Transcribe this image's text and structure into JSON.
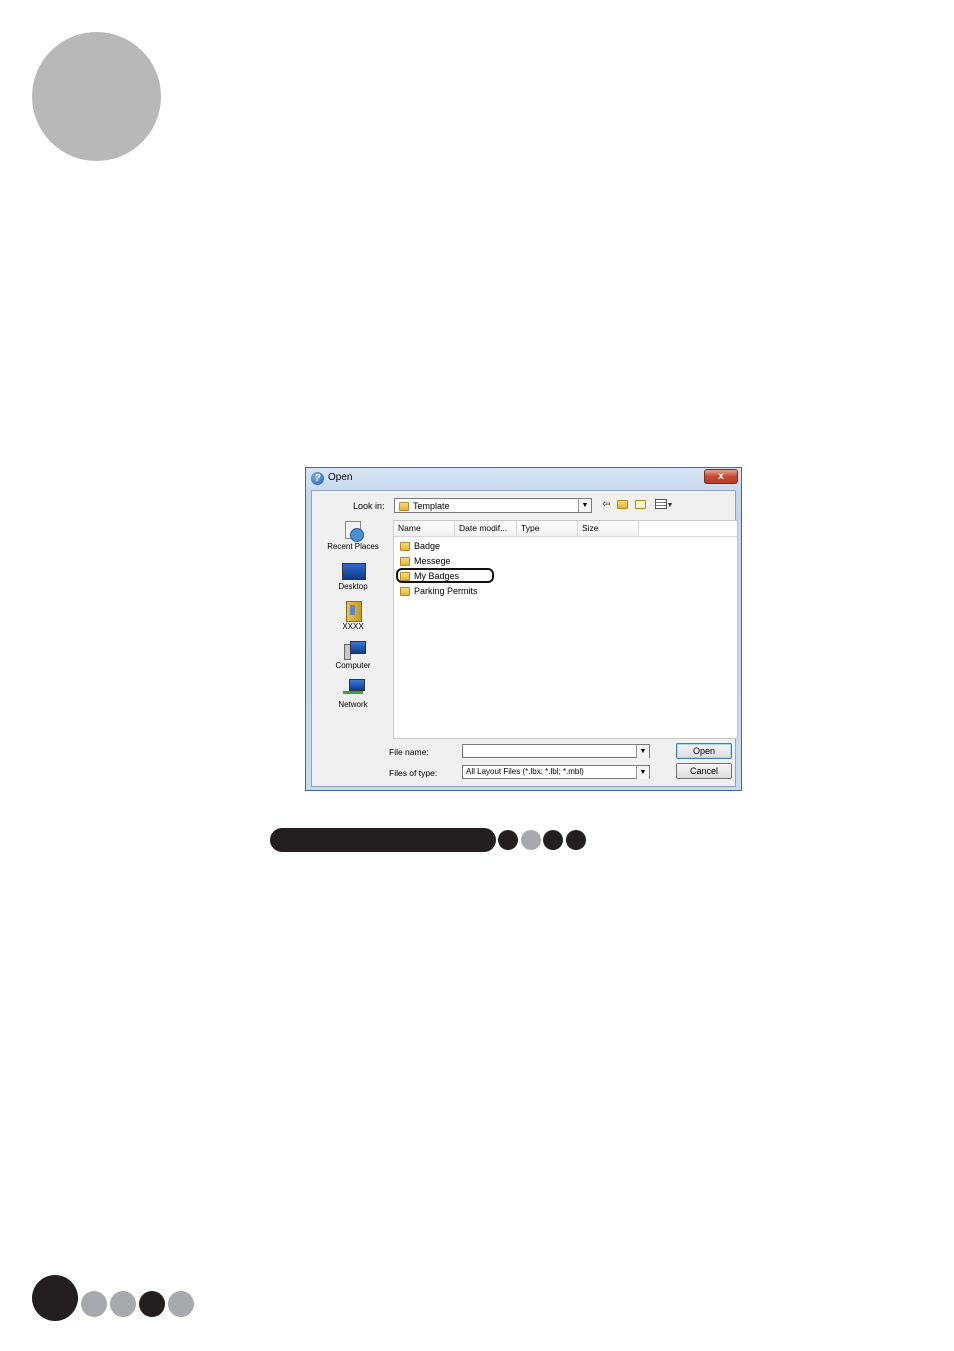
{
  "dialog": {
    "title": "Open",
    "close_glyph": "x",
    "look_in_label": "Look in:",
    "look_in_value": "Template",
    "toolbar_icons": [
      "back-icon",
      "up-folder-icon",
      "new-folder-icon",
      "views-menu-icon"
    ],
    "places": [
      {
        "label": "Recent Places",
        "icon": "recent-places-icon"
      },
      {
        "label": "Desktop",
        "icon": "desktop-icon"
      },
      {
        "label": "XXXX",
        "icon": "user-folder-icon"
      },
      {
        "label": "Computer",
        "icon": "computer-icon"
      },
      {
        "label": "Network",
        "icon": "network-icon"
      }
    ],
    "columns": [
      "Name",
      "Date modif...",
      "Type",
      "Size"
    ],
    "files": [
      "Badge",
      "Messege",
      "My Badges",
      "Parking Permits"
    ],
    "highlighted_file": "My Badges",
    "file_name_label": "File name:",
    "file_name_value": "",
    "file_type_label": "Files of type:",
    "file_type_value": "All Layout Files (*.lbx; *.lbl; *.mbl)",
    "open_button": "Open",
    "cancel_button": "Cancel"
  },
  "colors": {
    "big_circle": "#b8b8b8",
    "pill": "#231f20",
    "dark_dot": "#231f20",
    "gray_dot": "#a7a9ac"
  },
  "section_dots": [
    "dark",
    "gray",
    "dark",
    "dark"
  ],
  "page_dots": [
    "dark",
    "gray",
    "gray",
    "dark",
    "gray"
  ]
}
